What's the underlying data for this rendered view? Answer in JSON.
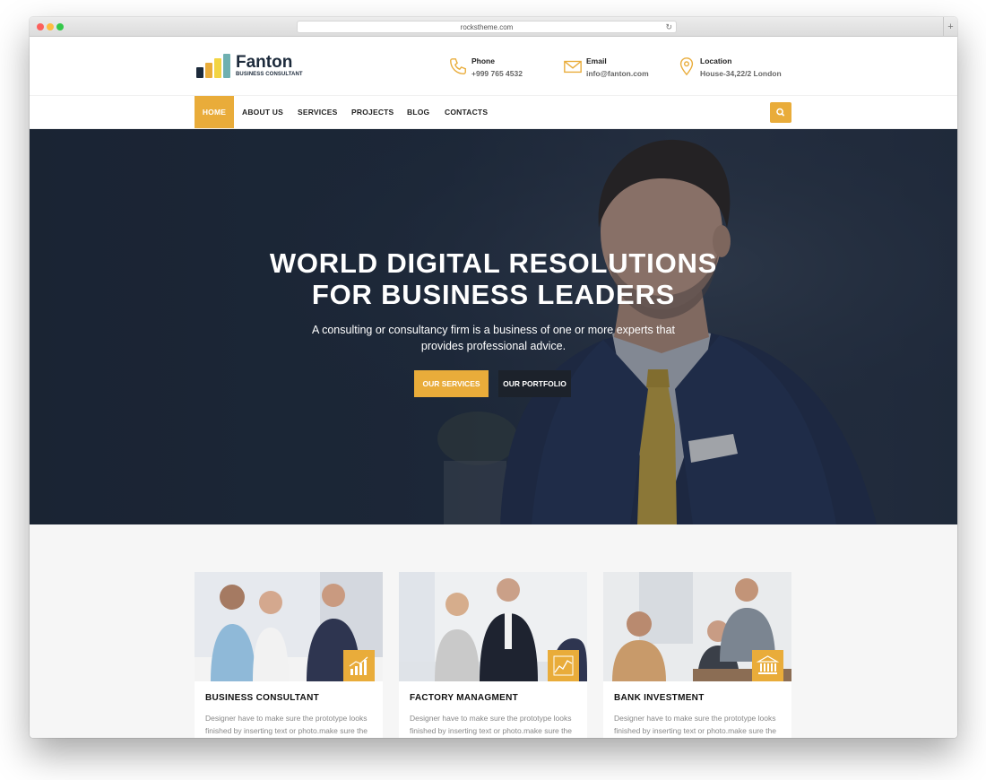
{
  "browser": {
    "url": "rockstheme.com"
  },
  "logo": {
    "title": "Fanton",
    "subtitle": "BUSINESS CONSULTANT"
  },
  "contact": [
    {
      "label": "Phone",
      "value": "+999 765 4532",
      "icon": "phone-icon"
    },
    {
      "label": "Email",
      "value": "info@fanton.com",
      "icon": "envelope-icon"
    },
    {
      "label": "Location",
      "value": "House-34,22/2 London",
      "icon": "map-pin-icon"
    }
  ],
  "nav": {
    "items": [
      "HOME",
      "ABOUT US",
      "SERVICES",
      "PROJECTS",
      "BLOG",
      "CONTACTS"
    ],
    "active": "HOME"
  },
  "hero": {
    "title_line1": "WORLD DIGITAL RESOLUTIONS",
    "title_line2": "FOR BUSINESS LEADERS",
    "subtitle_line1": "A consulting or consultancy firm is a business of one or more experts that",
    "subtitle_line2": "provides professional advice.",
    "primary_button": "OUR SERVICES",
    "secondary_button": "OUR PORTFOLIO"
  },
  "services": [
    {
      "title": "BUSINESS CONSULTANT",
      "desc": "Designer have to make sure the prototype looks finished by inserting text or photo.make sure the",
      "icon": "bar-chart-icon"
    },
    {
      "title": "FACTORY MANAGMENT",
      "desc": "Designer have to make sure the prototype looks finished by inserting text or photo.make sure the",
      "icon": "line-chart-icon"
    },
    {
      "title": "BANK INVESTMENT",
      "desc": "Designer have to make sure the prototype looks finished by inserting text or photo.make sure the",
      "icon": "bank-icon"
    }
  ],
  "colors": {
    "accent": "#e9ac3a",
    "dark": "#1c222b",
    "hero_bg": "#1e2a3c"
  }
}
